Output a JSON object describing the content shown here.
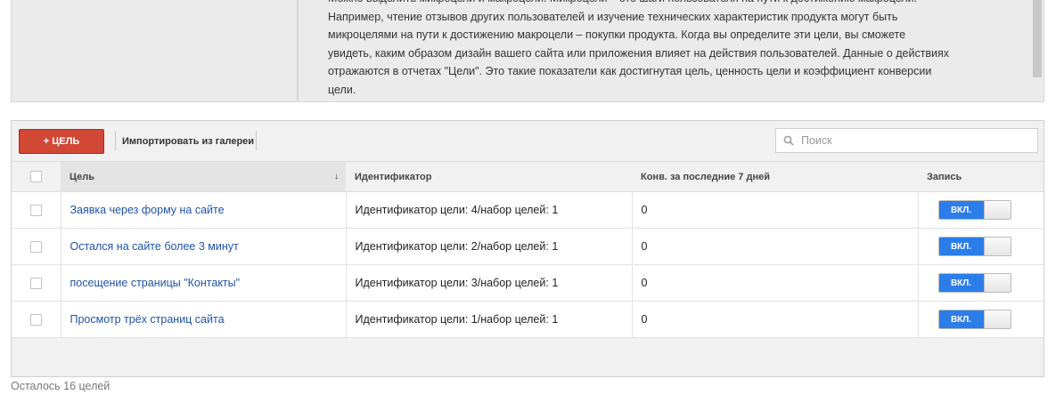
{
  "info": {
    "lines": [
      "Можно выделить микроцели и макроцели. Микроцели – это шаги пользователя на пути к достижению макроцели.",
      "Например, чтение отзывов других пользователей и изучение технических характеристик продукта могут быть",
      "микроцелями на пути к достижению макроцели – покупки продукта. Когда вы определите эти цели, вы сможете",
      "увидеть, каким образом дизайн вашего сайта или приложения влияет на действия пользователей. Данные о действиях",
      "отражаются в отчетах \"Цели\". Это такие показатели как достигнутая цель, ценность цели и коэффициент конверсии",
      "цели."
    ]
  },
  "toolbar": {
    "add_label": "+ ЦЕЛЬ",
    "import_label": "Импортировать из галереи",
    "search_placeholder": "Поиск"
  },
  "table": {
    "headers": {
      "goal": "Цель",
      "sort_indicator": "↓",
      "id": "Идентификатор",
      "conv": "Конв. за последние 7 дней",
      "record": "Запись"
    },
    "rows": [
      {
        "name": "Заявка через форму на сайте",
        "id": "Идентификатор цели: 4/набор целей: 1",
        "conv": "0",
        "status": "ВКЛ."
      },
      {
        "name": "Остался на сайте более 3 минут",
        "id": "Идентификатор цели: 2/набор целей: 1",
        "conv": "0",
        "status": "ВКЛ."
      },
      {
        "name": "посещение страницы \"Контакты\"",
        "id": "Идентификатор цели: 3/набор целей: 1",
        "conv": "0",
        "status": "ВКЛ."
      },
      {
        "name": "Просмотр трёх страниц сайта",
        "id": "Идентификатор цели: 1/набор целей: 1",
        "conv": "0",
        "status": "ВКЛ."
      }
    ]
  },
  "footer": {
    "remaining": "Осталось 16 целей"
  },
  "colors": {
    "add_button": "#d14836",
    "toggle_on": "#2b7de9",
    "link": "#1f53a8"
  },
  "icons": {
    "search": "search-icon",
    "sort": "sort-down-icon"
  }
}
